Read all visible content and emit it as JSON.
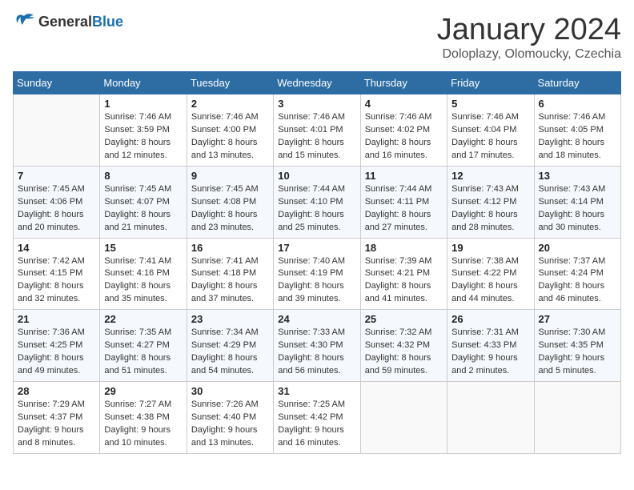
{
  "header": {
    "logo_general": "General",
    "logo_blue": "Blue",
    "month_title": "January 2024",
    "subtitle": "Doloplazy, Olomoucky, Czechia"
  },
  "weekdays": [
    "Sunday",
    "Monday",
    "Tuesday",
    "Wednesday",
    "Thursday",
    "Friday",
    "Saturday"
  ],
  "weeks": [
    [
      {
        "day": "",
        "info": ""
      },
      {
        "day": "1",
        "info": "Sunrise: 7:46 AM\nSunset: 3:59 PM\nDaylight: 8 hours\nand 12 minutes."
      },
      {
        "day": "2",
        "info": "Sunrise: 7:46 AM\nSunset: 4:00 PM\nDaylight: 8 hours\nand 13 minutes."
      },
      {
        "day": "3",
        "info": "Sunrise: 7:46 AM\nSunset: 4:01 PM\nDaylight: 8 hours\nand 15 minutes."
      },
      {
        "day": "4",
        "info": "Sunrise: 7:46 AM\nSunset: 4:02 PM\nDaylight: 8 hours\nand 16 minutes."
      },
      {
        "day": "5",
        "info": "Sunrise: 7:46 AM\nSunset: 4:04 PM\nDaylight: 8 hours\nand 17 minutes."
      },
      {
        "day": "6",
        "info": "Sunrise: 7:46 AM\nSunset: 4:05 PM\nDaylight: 8 hours\nand 18 minutes."
      }
    ],
    [
      {
        "day": "7",
        "info": "Sunrise: 7:45 AM\nSunset: 4:06 PM\nDaylight: 8 hours\nand 20 minutes."
      },
      {
        "day": "8",
        "info": "Sunrise: 7:45 AM\nSunset: 4:07 PM\nDaylight: 8 hours\nand 21 minutes."
      },
      {
        "day": "9",
        "info": "Sunrise: 7:45 AM\nSunset: 4:08 PM\nDaylight: 8 hours\nand 23 minutes."
      },
      {
        "day": "10",
        "info": "Sunrise: 7:44 AM\nSunset: 4:10 PM\nDaylight: 8 hours\nand 25 minutes."
      },
      {
        "day": "11",
        "info": "Sunrise: 7:44 AM\nSunset: 4:11 PM\nDaylight: 8 hours\nand 27 minutes."
      },
      {
        "day": "12",
        "info": "Sunrise: 7:43 AM\nSunset: 4:12 PM\nDaylight: 8 hours\nand 28 minutes."
      },
      {
        "day": "13",
        "info": "Sunrise: 7:43 AM\nSunset: 4:14 PM\nDaylight: 8 hours\nand 30 minutes."
      }
    ],
    [
      {
        "day": "14",
        "info": "Sunrise: 7:42 AM\nSunset: 4:15 PM\nDaylight: 8 hours\nand 32 minutes."
      },
      {
        "day": "15",
        "info": "Sunrise: 7:41 AM\nSunset: 4:16 PM\nDaylight: 8 hours\nand 35 minutes."
      },
      {
        "day": "16",
        "info": "Sunrise: 7:41 AM\nSunset: 4:18 PM\nDaylight: 8 hours\nand 37 minutes."
      },
      {
        "day": "17",
        "info": "Sunrise: 7:40 AM\nSunset: 4:19 PM\nDaylight: 8 hours\nand 39 minutes."
      },
      {
        "day": "18",
        "info": "Sunrise: 7:39 AM\nSunset: 4:21 PM\nDaylight: 8 hours\nand 41 minutes."
      },
      {
        "day": "19",
        "info": "Sunrise: 7:38 AM\nSunset: 4:22 PM\nDaylight: 8 hours\nand 44 minutes."
      },
      {
        "day": "20",
        "info": "Sunrise: 7:37 AM\nSunset: 4:24 PM\nDaylight: 8 hours\nand 46 minutes."
      }
    ],
    [
      {
        "day": "21",
        "info": "Sunrise: 7:36 AM\nSunset: 4:25 PM\nDaylight: 8 hours\nand 49 minutes."
      },
      {
        "day": "22",
        "info": "Sunrise: 7:35 AM\nSunset: 4:27 PM\nDaylight: 8 hours\nand 51 minutes."
      },
      {
        "day": "23",
        "info": "Sunrise: 7:34 AM\nSunset: 4:29 PM\nDaylight: 8 hours\nand 54 minutes."
      },
      {
        "day": "24",
        "info": "Sunrise: 7:33 AM\nSunset: 4:30 PM\nDaylight: 8 hours\nand 56 minutes."
      },
      {
        "day": "25",
        "info": "Sunrise: 7:32 AM\nSunset: 4:32 PM\nDaylight: 8 hours\nand 59 minutes."
      },
      {
        "day": "26",
        "info": "Sunrise: 7:31 AM\nSunset: 4:33 PM\nDaylight: 9 hours\nand 2 minutes."
      },
      {
        "day": "27",
        "info": "Sunrise: 7:30 AM\nSunset: 4:35 PM\nDaylight: 9 hours\nand 5 minutes."
      }
    ],
    [
      {
        "day": "28",
        "info": "Sunrise: 7:29 AM\nSunset: 4:37 PM\nDaylight: 9 hours\nand 8 minutes."
      },
      {
        "day": "29",
        "info": "Sunrise: 7:27 AM\nSunset: 4:38 PM\nDaylight: 9 hours\nand 10 minutes."
      },
      {
        "day": "30",
        "info": "Sunrise: 7:26 AM\nSunset: 4:40 PM\nDaylight: 9 hours\nand 13 minutes."
      },
      {
        "day": "31",
        "info": "Sunrise: 7:25 AM\nSunset: 4:42 PM\nDaylight: 9 hours\nand 16 minutes."
      },
      {
        "day": "",
        "info": ""
      },
      {
        "day": "",
        "info": ""
      },
      {
        "day": "",
        "info": ""
      }
    ]
  ]
}
